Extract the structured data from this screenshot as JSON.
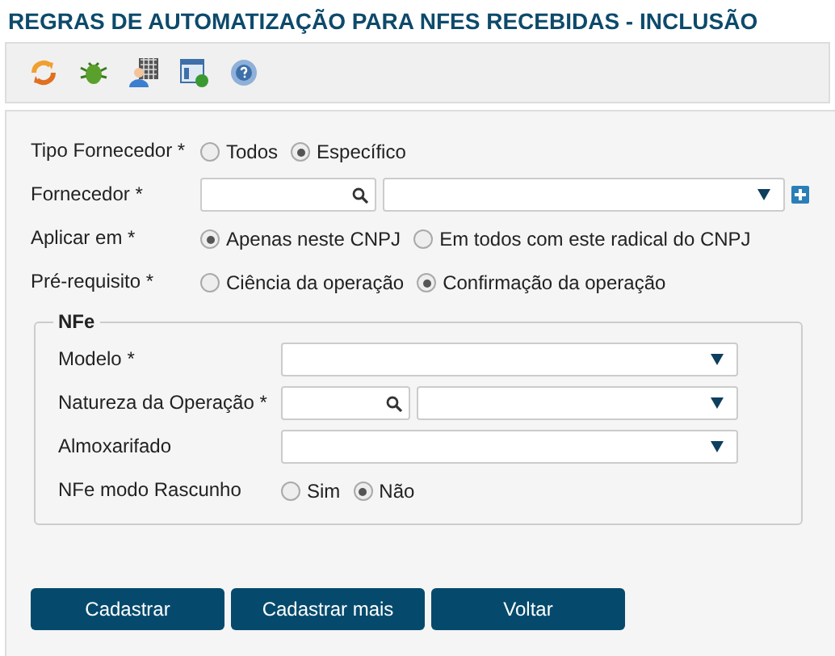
{
  "title": "REGRAS DE AUTOMATIZAÇÃO PARA NFES RECEBIDAS - INCLUSÃO",
  "toolbar": [
    {
      "kind": "refresh"
    },
    {
      "kind": "bug"
    },
    {
      "kind": "user-grid"
    },
    {
      "kind": "form-add"
    },
    {
      "kind": "help"
    }
  ],
  "fields": [
    {
      "kind": "radio",
      "label": "Tipo Fornecedor *",
      "options": [
        {
          "label": "Todos",
          "selected": false
        },
        {
          "label": "Específico",
          "selected": true
        }
      ]
    },
    {
      "kind": "lookup",
      "label": "Fornecedor *",
      "add": true
    },
    {
      "kind": "radio",
      "label": "Aplicar em *",
      "options": [
        {
          "label": "Apenas neste CNPJ",
          "selected": true
        },
        {
          "label": "Em todos com este radical do CNPJ",
          "selected": false
        }
      ]
    },
    {
      "kind": "radio",
      "label": "Pré-requisito *",
      "options": [
        {
          "label": "Ciência da operação",
          "selected": false
        },
        {
          "label": "Confirmação da operação",
          "selected": true
        }
      ]
    }
  ],
  "nfe": {
    "legend": "NFe",
    "fields": [
      {
        "kind": "select",
        "label": "Modelo *"
      },
      {
        "kind": "lookup",
        "label": "Natureza da Operação *",
        "add": false
      },
      {
        "kind": "select",
        "label": "Almoxarifado"
      },
      {
        "kind": "radio",
        "label": "NFe modo Rascunho",
        "options": [
          {
            "label": "Sim",
            "selected": false
          },
          {
            "label": "Não",
            "selected": true
          }
        ]
      }
    ]
  },
  "buttons": [
    "Cadastrar",
    "Cadastrar mais",
    "Voltar"
  ]
}
